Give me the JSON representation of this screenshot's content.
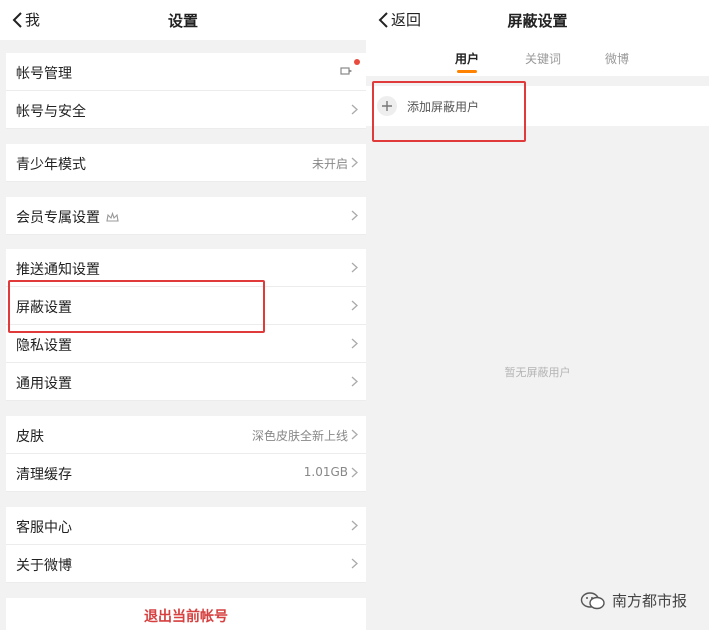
{
  "left": {
    "back_label": "我",
    "title": "设置",
    "rows": [
      {
        "label": "帐号管理"
      },
      {
        "label": "帐号与安全"
      },
      {
        "label": "青少年模式",
        "value": "未开启"
      },
      {
        "label": "会员专属设置"
      },
      {
        "label": "推送通知设置"
      },
      {
        "label": "屏蔽设置"
      },
      {
        "label": "隐私设置"
      },
      {
        "label": "通用设置"
      },
      {
        "label": "皮肤",
        "value": "深色皮肤全新上线"
      },
      {
        "label": "清理缓存",
        "value": "1.01GB"
      },
      {
        "label": "客服中心"
      },
      {
        "label": "关于微博"
      }
    ],
    "logout_label": "退出当前帐号"
  },
  "right": {
    "back_label": "返回",
    "title": "屏蔽设置",
    "tabs": [
      {
        "label": "用户",
        "active": true
      },
      {
        "label": "关键词"
      },
      {
        "label": "微博"
      }
    ],
    "add_label": "添加屏蔽用户",
    "empty_text": "暂无屏蔽用户"
  },
  "watermark": {
    "label": "南方都市报"
  },
  "colors": {
    "accent": "#ff8200",
    "highlight": "#e03a3a",
    "logout": "#d64040",
    "dot": "#e94b3c"
  },
  "icons": [
    "chevron-left-icon",
    "chevron-right-icon",
    "plus-icon",
    "vip-crown-icon",
    "account-switch-icon",
    "wechat-logo-icon"
  ]
}
